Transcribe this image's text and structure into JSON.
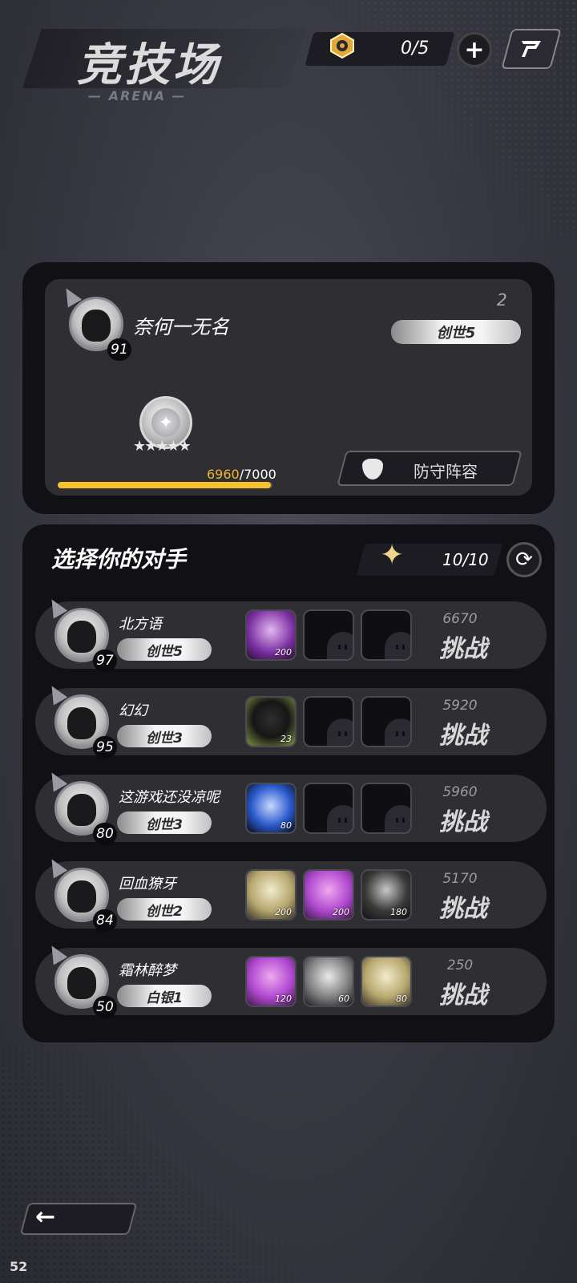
{
  "header": {
    "title": "竞技场",
    "subtitle": "— ARENA —",
    "resource_count": "0/5",
    "resource_icon": "medal-token-icon",
    "plus_icon": "plus-icon",
    "share_icon": "share-icon"
  },
  "player": {
    "name": "奈何一无名",
    "level": "91",
    "rank_position": "2",
    "tier": "创世5",
    "xp_current": "6960",
    "xp_total": "/7000",
    "xp_progress": 0.994,
    "stars": "★★★★★",
    "defense_label": "防守阵容",
    "accent_color": "#f5c12e"
  },
  "opponents": {
    "heading": "选择你的对手",
    "tickets": "10/10",
    "ticket_icon": "star-ticket-icon",
    "refresh_icon": "refresh-icon",
    "challenge_label": "挑战",
    "list": [
      {
        "name": "北方语",
        "level": "97",
        "tier": "创世5",
        "power": "6670",
        "team": [
          {
            "hero": "hero-purple",
            "level": "200"
          },
          {
            "hero": "empty"
          },
          {
            "hero": "empty"
          }
        ]
      },
      {
        "name": "幻幻",
        "level": "95",
        "tier": "创世3",
        "power": "5920",
        "team": [
          {
            "hero": "hero-dark",
            "level": "23"
          },
          {
            "hero": "empty"
          },
          {
            "hero": "empty"
          }
        ]
      },
      {
        "name": "这游戏还没凉呢",
        "level": "80",
        "tier": "创世3",
        "power": "5960",
        "team": [
          {
            "hero": "hero-blue",
            "level": "80"
          },
          {
            "hero": "empty"
          },
          {
            "hero": "empty"
          }
        ]
      },
      {
        "name": "回血獠牙",
        "level": "84",
        "tier": "创世2",
        "power": "5170",
        "team": [
          {
            "hero": "hero-blonde",
            "level": "200"
          },
          {
            "hero": "hero-pink",
            "level": "200"
          },
          {
            "hero": "hero-maid",
            "level": "180"
          }
        ]
      },
      {
        "name": "霜林醉梦",
        "level": "50",
        "tier": "白银1",
        "power": "250",
        "team": [
          {
            "hero": "hero-pink",
            "level": "120"
          },
          {
            "hero": "hero-grey",
            "level": "60"
          },
          {
            "hero": "hero-blonde",
            "level": "80"
          }
        ]
      }
    ]
  },
  "footer": {
    "back_icon": "back-arrow-icon",
    "back_glyph": "←",
    "fps": "52"
  }
}
